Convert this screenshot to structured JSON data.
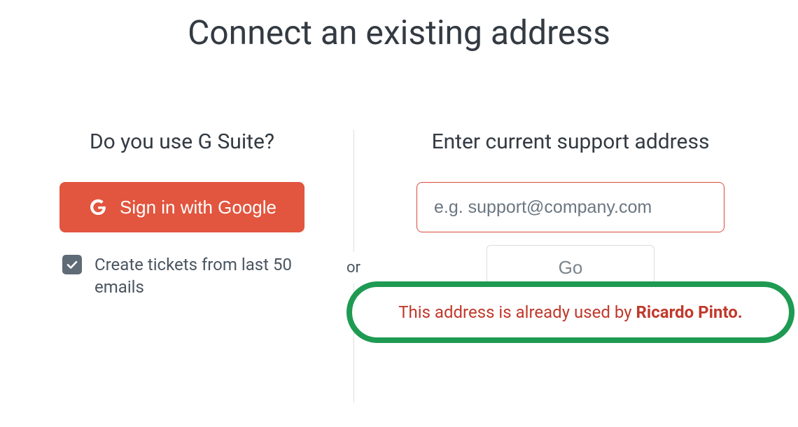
{
  "header": {
    "title": "Connect an existing address"
  },
  "left": {
    "heading": "Do you use G Suite?",
    "google_button_label": "Sign in with Google",
    "checkbox_checked": true,
    "checkbox_label": "Create tickets from last 50 emails"
  },
  "separator": {
    "or_label": "or"
  },
  "right": {
    "heading": "Enter current support address",
    "email_placeholder": "e.g. support@company.com",
    "email_value": "",
    "go_button_label": "Go",
    "error_prefix": "This address is already used by ",
    "error_name": "Ricardo Pinto."
  }
}
